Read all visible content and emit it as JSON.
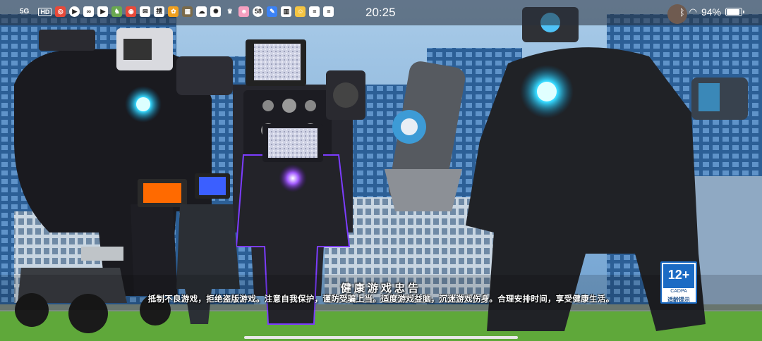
{
  "status_bar": {
    "signal": "5G",
    "hd_label": "HD",
    "time": "20:25",
    "battery": "94%",
    "battery_level": 0.94,
    "notification_icons": [
      "app-icon-1",
      "play-icon",
      "app-icon-2",
      "play-icon",
      "app-icon-3",
      "app-icon-4",
      "mail-icon",
      "search-app-icon",
      "app-icon-5",
      "app-icon-6",
      "app-icon-7",
      "app-icon-8",
      "app-icon-9",
      "crown-icon",
      "app-icon-10",
      "app-icon-11",
      "app-icon-12",
      "book-icon",
      "app-icon-13",
      "list-icon",
      "list-icon"
    ],
    "app_58_label": "58",
    "app_search_label": "搜"
  },
  "game": {
    "notice_title": "健康游戏忠告",
    "notice_text": "抵制不良游戏，拒绝盗版游戏。注意自我保护，谨防受骗上当。适度游戏益脑，沉迷游戏伤身。合理安排时间，享受健康生活。",
    "age_rating": "12+",
    "age_org": "CADPA",
    "age_tip": "适龄提示"
  },
  "colors": {
    "sky": "#7fb0dc",
    "building": "#2a5f97",
    "grass": "#5fa83a",
    "glow_cyan": "#22d3ff",
    "glow_purple": "#9a4dff",
    "rating_blue": "#1b6bc4"
  }
}
